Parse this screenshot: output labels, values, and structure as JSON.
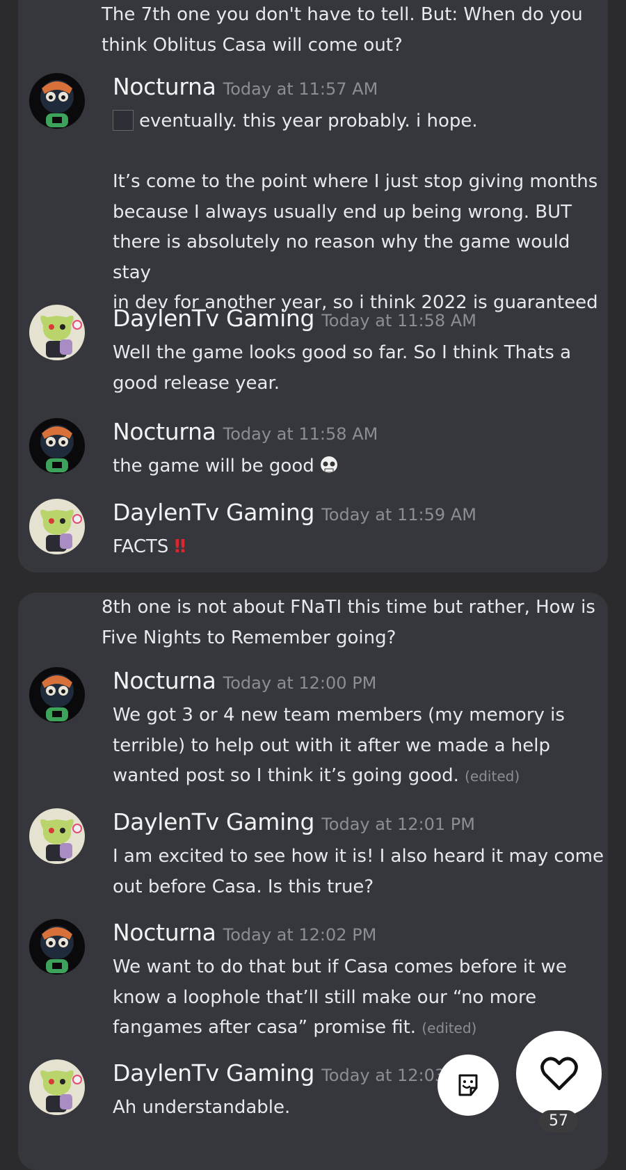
{
  "cards": [
    {
      "continuation": [
        "The 7th one you don't have to tell. But: When do you",
        "think Oblitus Casa will come out?"
      ],
      "messages": [
        {
          "author": "Nocturna",
          "time": "Today at 11:57 AM",
          "lines": [
            "eventually. this year probably. i hope.",
            "",
            "It’s come to the point where I just stop giving months",
            "because I always usually end up being wrong. BUT",
            "there is absolutely no reason why the game would stay",
            "in dev for another year, so i think 2022 is guaranteed"
          ]
        },
        {
          "author": "DaylenTv Gaming",
          "time": "Today at 11:58 AM",
          "lines": [
            "Well the game looks good so far. So I think Thats a",
            "good release year."
          ]
        },
        {
          "author": "Nocturna",
          "time": "Today at 11:58 AM",
          "lines": [
            "the game will be good"
          ]
        },
        {
          "author": "DaylenTv Gaming",
          "time": "Today at 11:59 AM",
          "lines": [
            "FACTS"
          ],
          "emphasis": "‼"
        }
      ]
    },
    {
      "continuation": [
        "8th one is not about FNaTI this time but rather, How is",
        "Five Nights to Remember going?"
      ],
      "messages": [
        {
          "author": "Nocturna",
          "time": "Today at 12:00 PM",
          "lines": [
            "We got 3 or 4 new team members (my memory is",
            "terrible) to help out with it after we made a help",
            "wanted post so I think it’s going good."
          ],
          "edited": "(edited)"
        },
        {
          "author": "DaylenTv Gaming",
          "time": "Today at 12:01 PM",
          "lines": [
            "I am excited to see how it is! I also heard it may come",
            "out before Casa. Is this true?"
          ]
        },
        {
          "author": "Nocturna",
          "time": "Today at 12:02 PM",
          "lines": [
            "We want to do that but if Casa comes before it we",
            "know a loophole that’ll still make our “no more",
            "fangames after casa” promise fit."
          ],
          "edited": "(edited)"
        },
        {
          "author": "DaylenTv Gaming",
          "time": "Today at 12:03 PM",
          "lines": [
            "Ah understandable."
          ]
        }
      ]
    }
  ],
  "actions": {
    "sticker_icon": "sticker-icon",
    "like_icon": "heart-icon",
    "like_count": "57"
  },
  "colors": {
    "background": "#2b2a2c",
    "card": "#36373c",
    "timestamp": "#8b8e95",
    "emphasis": "#e0262c"
  }
}
